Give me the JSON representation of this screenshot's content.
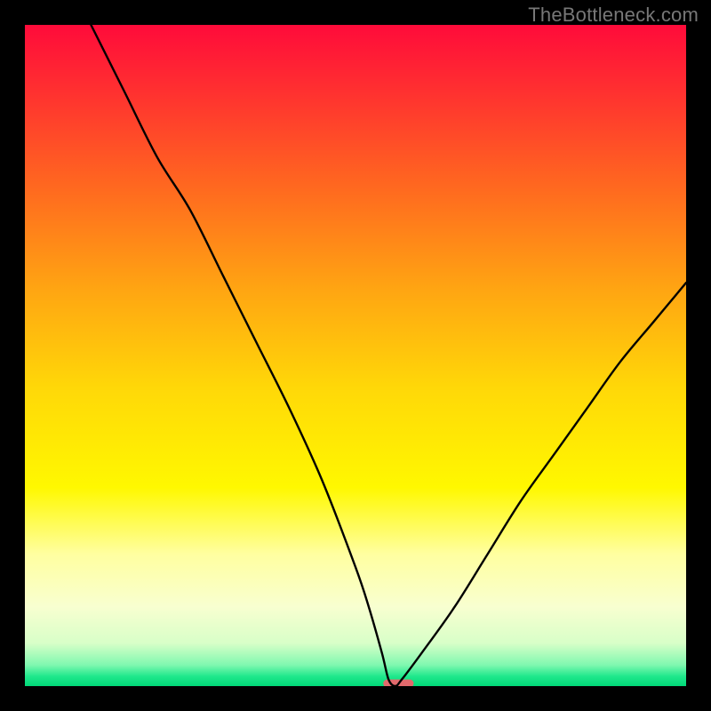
{
  "watermark": "TheBottleneck.com",
  "chart_data": {
    "type": "line",
    "title": "",
    "xlabel": "",
    "ylabel": "",
    "xlim": [
      0,
      100
    ],
    "ylim": [
      0,
      100
    ],
    "grid": false,
    "legend": false,
    "gradient_stops": [
      {
        "pos": 0.0,
        "color": "#ff0b3a"
      },
      {
        "pos": 0.1,
        "color": "#ff3030"
      },
      {
        "pos": 0.25,
        "color": "#ff6a1f"
      },
      {
        "pos": 0.4,
        "color": "#ffa512"
      },
      {
        "pos": 0.55,
        "color": "#ffd808"
      },
      {
        "pos": 0.7,
        "color": "#fff800"
      },
      {
        "pos": 0.8,
        "color": "#ffffa0"
      },
      {
        "pos": 0.88,
        "color": "#f8ffd0"
      },
      {
        "pos": 0.935,
        "color": "#d8ffc8"
      },
      {
        "pos": 0.968,
        "color": "#80f8b0"
      },
      {
        "pos": 0.985,
        "color": "#20e88c"
      },
      {
        "pos": 1.0,
        "color": "#00d878"
      }
    ],
    "series": [
      {
        "name": "bottleneck-curve",
        "color": "#000000",
        "x": [
          10,
          15,
          20,
          25,
          30,
          35,
          40,
          45,
          50,
          52,
          54,
          55,
          56,
          57,
          60,
          65,
          70,
          75,
          80,
          85,
          90,
          95,
          100
        ],
        "values": [
          100,
          90,
          80,
          72,
          62,
          52,
          42,
          31,
          18,
          12,
          5,
          1,
          0,
          1,
          5,
          12,
          20,
          28,
          35,
          42,
          49,
          55,
          61
        ]
      }
    ],
    "marker": {
      "name": "optimal-range",
      "color": "#e2696c",
      "x_start": 54.2,
      "x_end": 58.8,
      "y": 0.4,
      "height": 1.2
    }
  }
}
